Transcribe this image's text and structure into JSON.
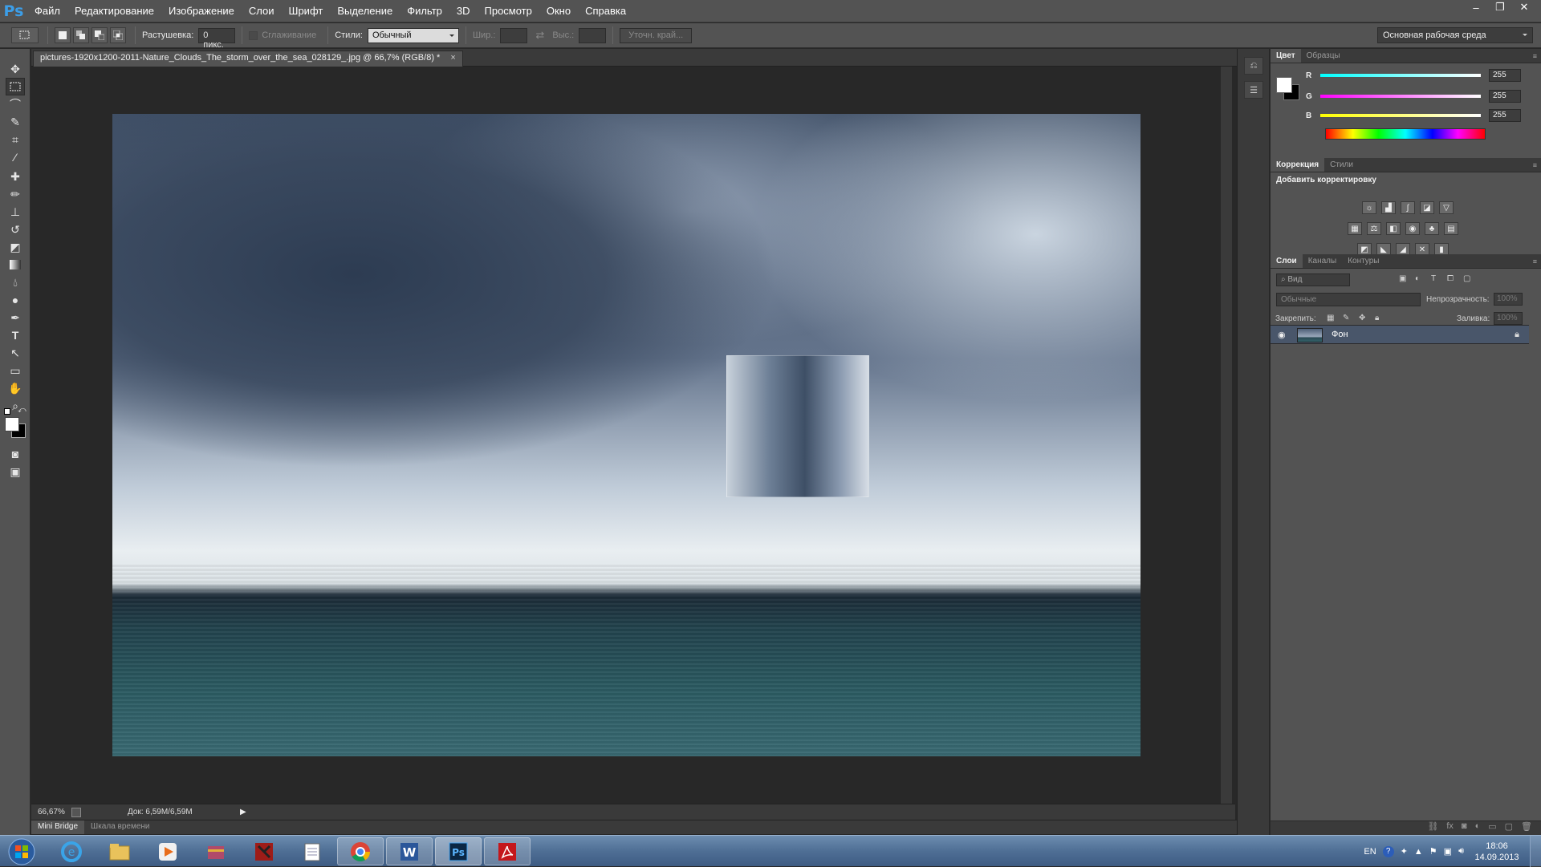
{
  "app": {
    "logo": "Ps",
    "menu": [
      "Файл",
      "Редактирование",
      "Изображение",
      "Слои",
      "Шрифт",
      "Выделение",
      "Фильтр",
      "3D",
      "Просмотр",
      "Окно",
      "Справка"
    ],
    "window_controls": [
      "–",
      "❐",
      "✕"
    ]
  },
  "options_bar": {
    "feather_label": "Растушевка:",
    "feather_value": "0 пикс.",
    "antialias_label": "Сглаживание",
    "style_label": "Стили:",
    "style_value": "Обычный",
    "width_label": "Шир.:",
    "height_label": "Выс.:",
    "refine_edge_label": "Уточн. край...",
    "workspace": "Основная рабочая среда"
  },
  "document": {
    "tab_title": "pictures-1920x1200-2011-Nature_Clouds_The_storm_over_the_sea_028129_.jpg @ 66,7% (RGB/8) *",
    "tab_close": "×",
    "zoom": "66,67%",
    "doc_size": "Док: 6,59M/6,59M"
  },
  "bottom_tabs": [
    "Mini Bridge",
    "Шкала времени"
  ],
  "color_panel": {
    "tabs": [
      "Цвет",
      "Образцы"
    ],
    "channels": [
      {
        "label": "R",
        "value": "255",
        "gradient": "#00ffff"
      },
      {
        "label": "G",
        "value": "255",
        "gradient": "#ff00ff"
      },
      {
        "label": "B",
        "value": "255",
        "gradient": "#ffff00"
      }
    ],
    "foreground": "#ffffff",
    "background": "#000000"
  },
  "adjustments_panel": {
    "tabs": [
      "Коррекция",
      "Стили"
    ],
    "title": "Добавить корректировку"
  },
  "layers_panel": {
    "tabs": [
      "Слои",
      "Каналы",
      "Контуры"
    ],
    "kind_filter": "Вид",
    "blend_mode": "Обычные",
    "opacity_label": "Непрозрачность:",
    "opacity_value": "100%",
    "lock_label": "Закрепить:",
    "fill_label": "Заливка:",
    "fill_value": "100%",
    "layers": [
      {
        "name": "Фон",
        "visible": true,
        "locked": true
      }
    ]
  },
  "taskbar": {
    "language": "EN",
    "time": "18:06",
    "date": "14.09.2013"
  }
}
